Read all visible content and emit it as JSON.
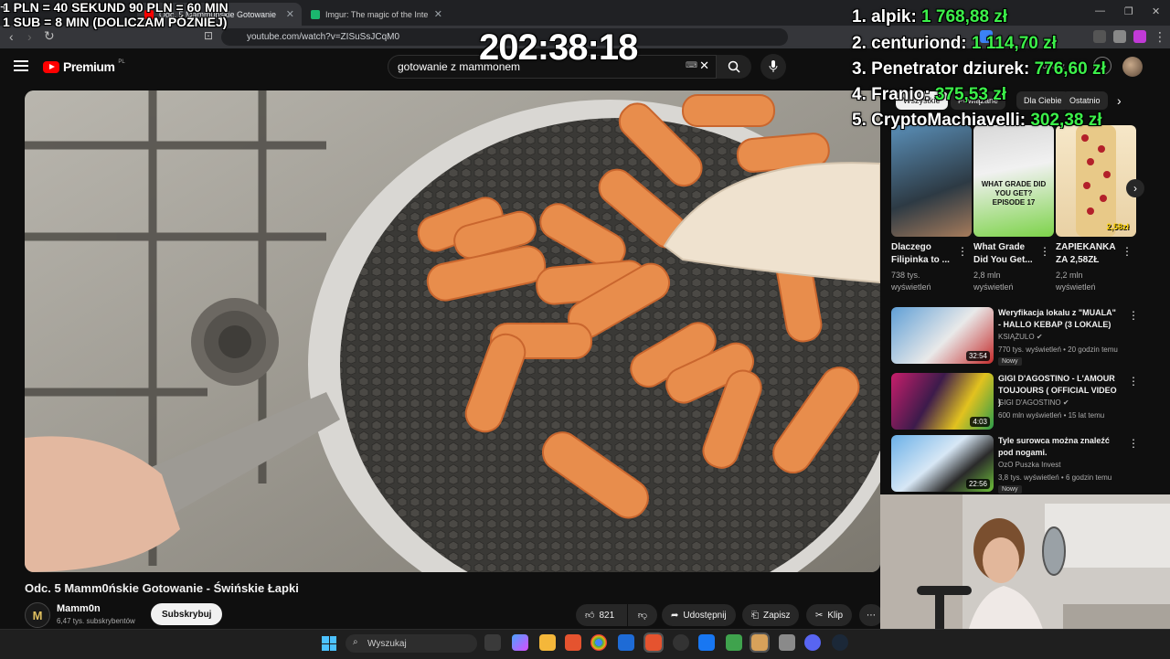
{
  "browser": {
    "tabs": [
      {
        "label": "Odc. 5 Mamm0ńskie Gotowanie",
        "active": true
      },
      {
        "label": "Imgur: The magic of the Internet",
        "active": false
      }
    ],
    "url": "youtube.com/watch?v=ZISuSsJCqM0"
  },
  "overlay": {
    "rates_line1": "1 PLN = 40 SEKUND 90 PLN = 60 MIN",
    "rates_line2": "1 SUB = 8 MIN (DOLICZAM PÓŹNIEJ)",
    "timer": "202:38:18",
    "leaderboard": [
      {
        "rank": "1.",
        "name": "alpik:",
        "amount": "1 768,88 zł"
      },
      {
        "rank": "2.",
        "name": "centuriond:",
        "amount": "1 114,70 zł"
      },
      {
        "rank": "3.",
        "name": "Penetrator dziurek:",
        "amount": "776,60 zł"
      },
      {
        "rank": "4.",
        "name": "Franio:",
        "amount": "375,53 zł"
      },
      {
        "rank": "5.",
        "name": "CryptoMachiavelli:",
        "amount": "302,38 zł"
      }
    ]
  },
  "youtube": {
    "logo_text": "Premium",
    "logo_region": "PL",
    "search_query": "gotowanie z mammonem",
    "video": {
      "title": "Odc. 5 Mamm0ńskie Gotowanie - Świńskie Łapki",
      "channel": "Mamm0n",
      "channel_initial": "M",
      "subscribers": "6,47 tys. subskrybentów",
      "subscribe_label": "Subskrybuj",
      "likes": "821",
      "share_label": "Udostępnij",
      "save_label": "Zapisz",
      "clip_label": "Klip"
    },
    "chips": [
      "Wszystkie",
      "Powiązane",
      "Dla Ciebie",
      "Ostatnio"
    ],
    "shorts": [
      {
        "title": "Dlaczego Filipinka to ...",
        "views": "738 tys. wyświetleń",
        "thumb_text": ""
      },
      {
        "title": "What Grade Did You Get...",
        "views": "2,8 mln wyświetleń",
        "thumb_text": "WHAT GRADE DID YOU GET? EPISODE 17"
      },
      {
        "title": "ZAPIEKANKA ZA 2,58ZŁ",
        "views": "2,2 mln wyświetleń",
        "thumb_text": "2,58zł"
      }
    ],
    "recommended": [
      {
        "title": "Weryfikacja lokalu z \"MUALA\" - HALLO KEBAP (3 LOKALE)",
        "channel": "KSIĄŻULO",
        "meta": "770 tys. wyświetleń • 20 godzin temu",
        "duration": "32:54",
        "badge": "Nowy"
      },
      {
        "title": "GIGI D'AGOSTINO - L'AMOUR TOUJOURS ( OFFICIAL VIDEO )",
        "channel": "GIGI D'AGOSTINO",
        "meta": "600 mln wyświetleń • 15 lat temu",
        "duration": "4:03",
        "badge": ""
      },
      {
        "title": "Tyle surowca można znaleźć pod nogami.",
        "channel": "OzO Puszka Invest",
        "meta": "3,8 tys. wyświetleń • 6 godzin temu",
        "duration": "22:56",
        "badge": "Nowy"
      }
    ]
  },
  "taskbar": {
    "search_placeholder": "Wyszukaj"
  }
}
